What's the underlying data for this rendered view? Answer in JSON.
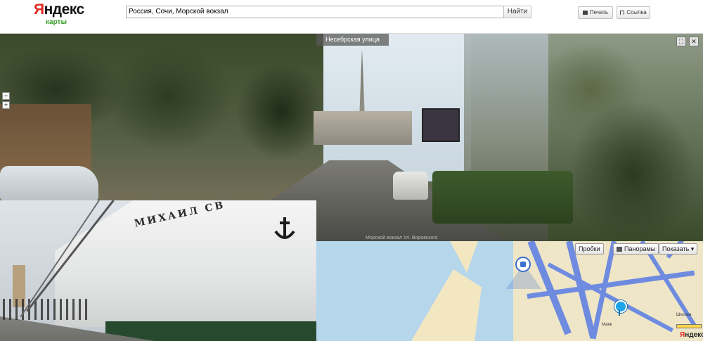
{
  "header": {
    "logo_text_first": "Я",
    "logo_text_rest": "ндекс",
    "logo_sub": "карты",
    "search_value": "Россия, Сочи, Морской вокзал",
    "search_button": "Найти",
    "print_button": "Печать",
    "link_button": "Ссылка"
  },
  "panorama": {
    "street_name": "Несебрская улица",
    "copyright": "Морской вокзал Ул. Воровского",
    "zoom_in": "+",
    "zoom_out": "−",
    "fullscreen_icon": "⛶",
    "close_icon": "✕"
  },
  "photo": {
    "ship_name": "МИХАИЛ СВ"
  },
  "map": {
    "traffic_button": "Пробки",
    "panoramas_button": "Панорамы",
    "show_button": "Показать ▾",
    "street_label_1": "Школьн.",
    "street_label_2": "Маяк",
    "logo_first": "Я",
    "logo_rest": "ндекс"
  }
}
